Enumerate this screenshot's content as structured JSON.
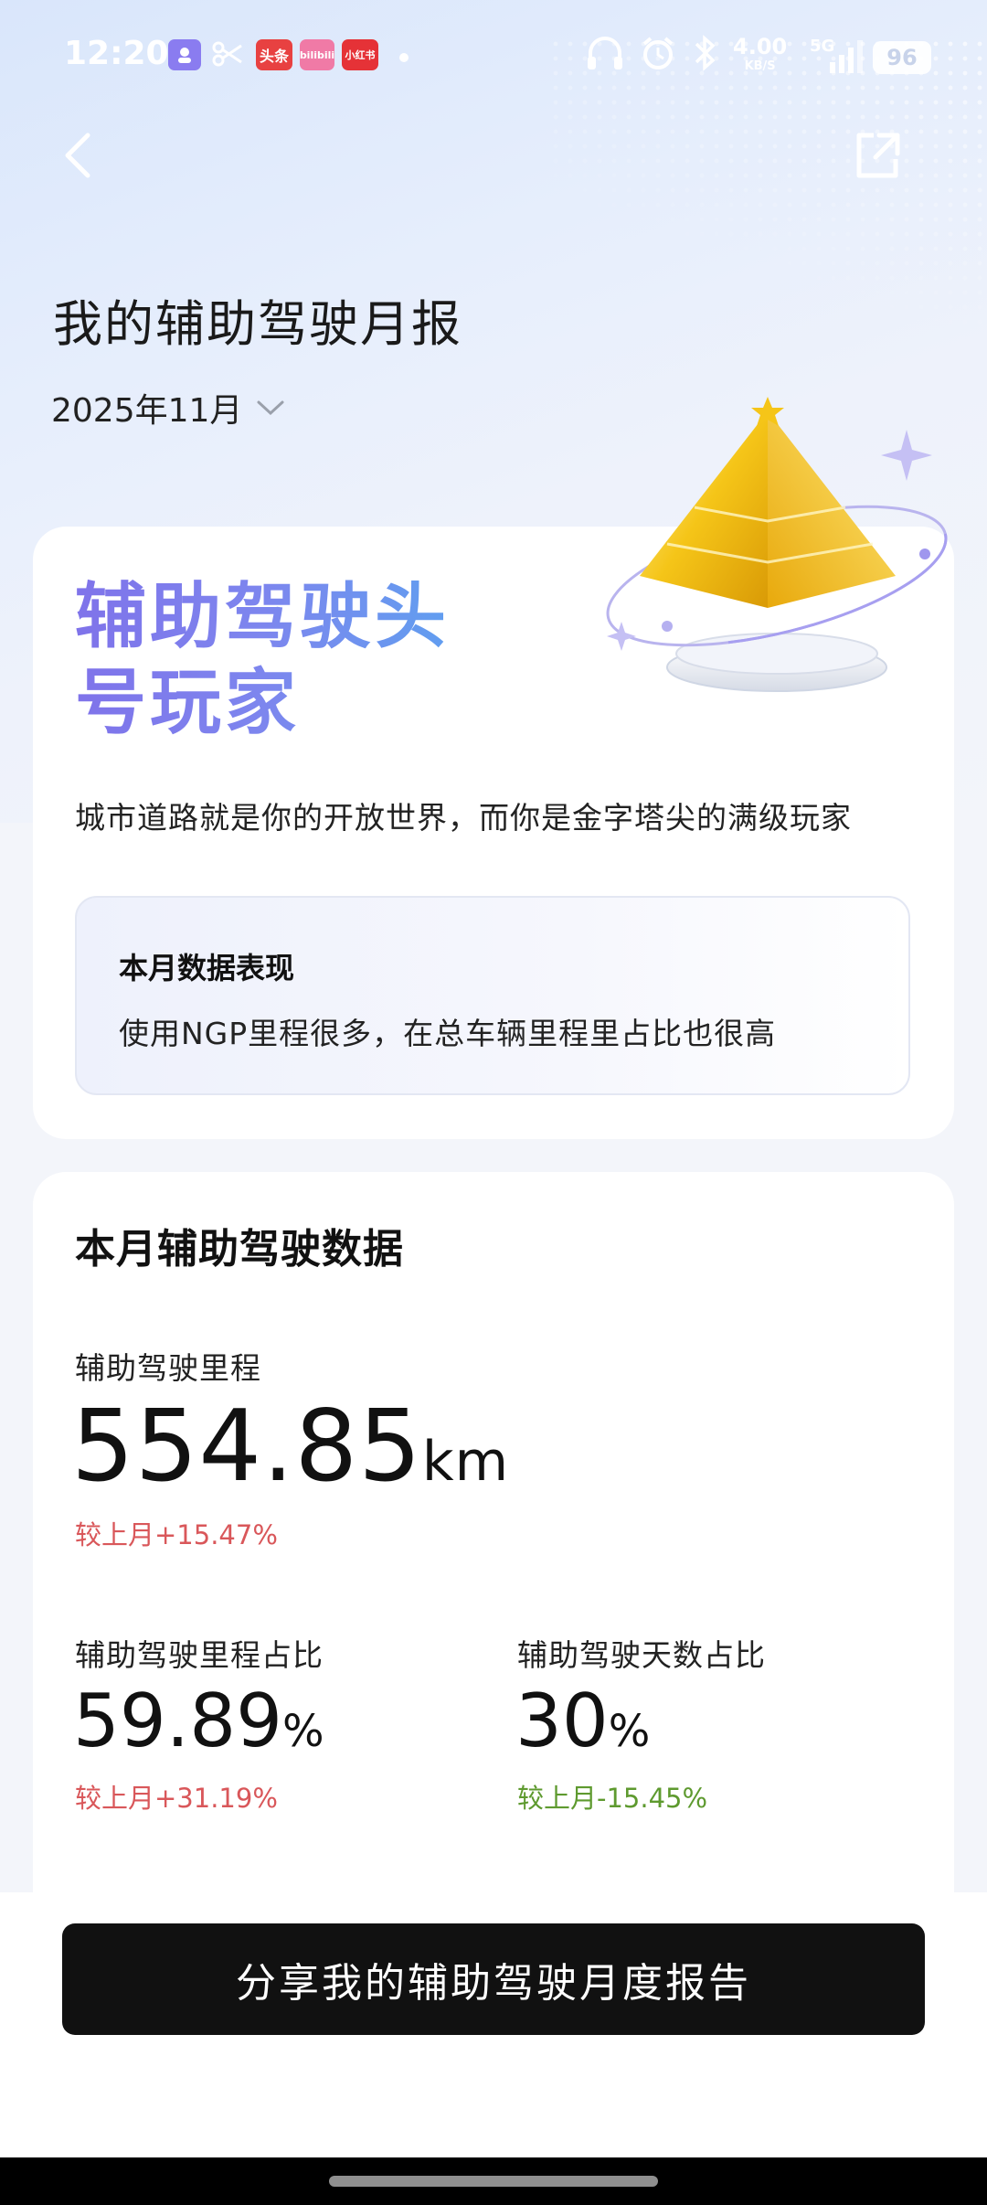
{
  "status_bar": {
    "time": "12:20",
    "app_badges": [
      "头条",
      "bilibili",
      "小红书"
    ],
    "network_speed": "4.00",
    "network_unit": "KB/S",
    "signal": "5G",
    "battery": "96"
  },
  "header": {
    "back_icon": "chevron-left-icon",
    "share_icon": "share-icon",
    "title": "我的辅助驾驶月报",
    "month": "2025年11月"
  },
  "badge_card": {
    "title": "辅助驾驶头号玩家",
    "description": "城市道路就是你的开放世界，而你是金字塔尖的满级玩家",
    "performance": {
      "title": "本月数据表现",
      "text": "使用NGP里程很多，在总车辆里程里占比也很高"
    }
  },
  "stats_card": {
    "title": "本月辅助驾驶数据",
    "mileage": {
      "label": "辅助驾驶里程",
      "value": "554.85",
      "unit": "km",
      "delta": "较上月+15.47%"
    },
    "mileage_ratio": {
      "label": "辅助驾驶里程占比",
      "value": "59.89",
      "unit": "%",
      "delta": "较上月+31.19%"
    },
    "days_ratio": {
      "label": "辅助驾驶天数占比",
      "value": "30",
      "unit": "%",
      "delta": "较上月-15.45%"
    }
  },
  "share_button": {
    "label": "分享我的辅助驾驶月度报告"
  },
  "colors": {
    "delta_up": "#d9575a",
    "delta_down": "#5e9a2f",
    "button_bg": "#111111"
  }
}
